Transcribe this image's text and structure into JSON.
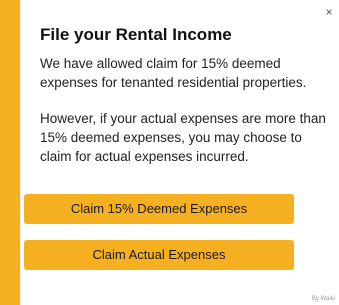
{
  "dialog": {
    "close_symbol": "×",
    "title": "File your Rental Income",
    "paragraph_1": "We have allowed claim for 15% deemed expenses for tenanted residential properties.",
    "paragraph_2": "However, if your actual expenses are more than 15% deemed expenses, you may choose to claim for actual expenses incurred.",
    "buttons": {
      "deemed_label": "Claim 15% Deemed Expenses",
      "actual_label": "Claim Actual Expenses"
    },
    "footer_text": "By Walki"
  },
  "colors": {
    "accent": "#f5b022",
    "text": "#222222",
    "title": "#111111"
  },
  "icons": {
    "close": "close-icon"
  }
}
